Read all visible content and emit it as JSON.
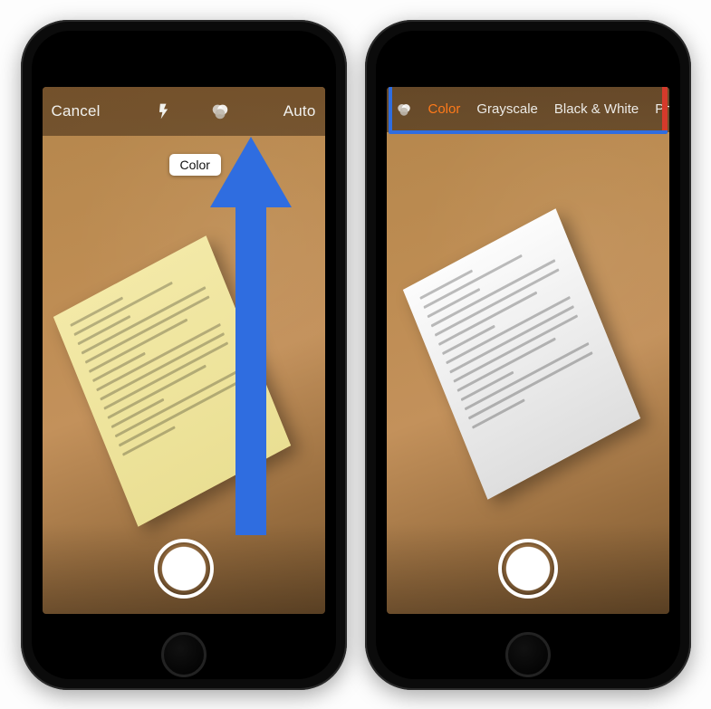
{
  "phoneA": {
    "cancel_label": "Cancel",
    "auto_label": "Auto",
    "tooltip_label": "Color",
    "icons": {
      "flash": "flash-icon",
      "filter": "filter-icon"
    },
    "annotation": {
      "arrow_color": "#2f6de0"
    }
  },
  "phoneB": {
    "filter_icon": "filter-icon",
    "filter_options": [
      {
        "label": "Color",
        "active": true
      },
      {
        "label": "Grayscale",
        "active": false
      },
      {
        "label": "Black & White",
        "active": false
      },
      {
        "label": "Photo",
        "active": false
      }
    ],
    "annotation": {
      "highlight_color": "#2f6de0"
    }
  }
}
